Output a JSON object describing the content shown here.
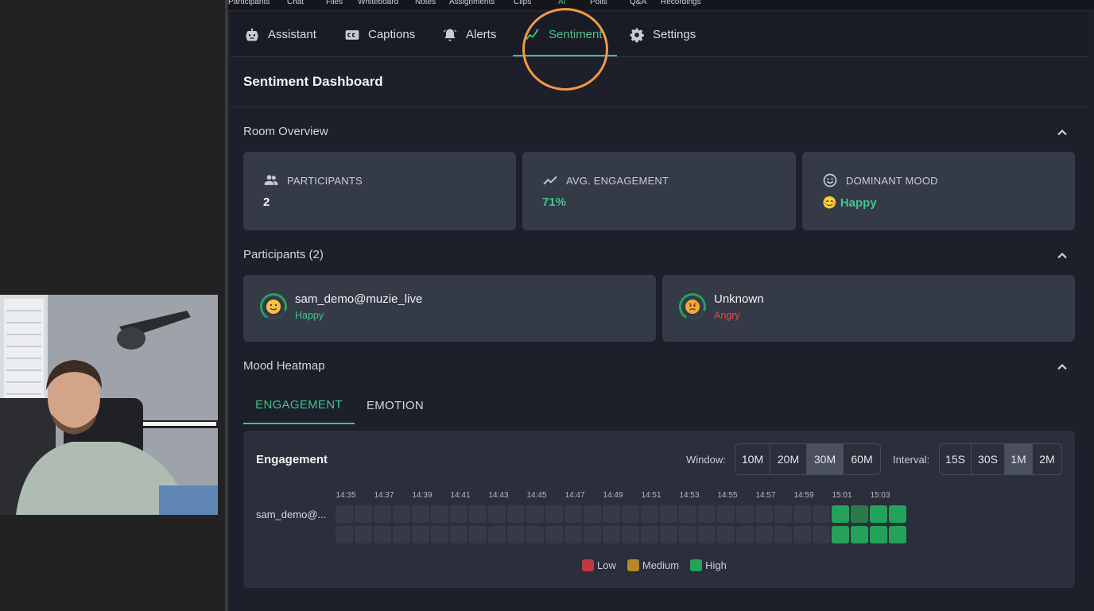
{
  "top_nav": [
    "Participants",
    "Chat",
    "Files",
    "Whiteboard",
    "Notes",
    "Assignments",
    "Clips",
    "AI",
    "Polls",
    "Q&A",
    "Recordings"
  ],
  "tabs": [
    {
      "label": "Assistant",
      "icon": "robot-icon"
    },
    {
      "label": "Captions",
      "icon": "closed-captions-icon"
    },
    {
      "label": "Alerts",
      "icon": "alarm-bell-icon"
    },
    {
      "label": "Sentiment",
      "icon": "sparkle-trend-icon",
      "active": true
    },
    {
      "label": "Settings",
      "icon": "gear-icon"
    }
  ],
  "dashboard_title": "Sentiment Dashboard",
  "room_overview": {
    "title": "Room Overview",
    "stats": [
      {
        "label": "PARTICIPANTS",
        "value": "2",
        "icon": "people-icon"
      },
      {
        "label": "AVG. ENGAGEMENT",
        "value": "71%",
        "icon": "trend-line-icon"
      },
      {
        "label": "DOMINANT MOOD",
        "value": "😊 Happy",
        "icon": "smiley-icon"
      }
    ]
  },
  "participants": {
    "title": "Participants (2)",
    "list": [
      {
        "name": "sam_demo@muzie_live",
        "mood": "Happy",
        "emoji": "😊",
        "mood_color": "#3fc48b"
      },
      {
        "name": "Unknown",
        "mood": "Angry",
        "emoji": "😠",
        "mood_color": "#e5484d"
      }
    ]
  },
  "mood_heatmap": {
    "title": "Mood Heatmap",
    "tabs": [
      "ENGAGEMENT",
      "EMOTION"
    ],
    "active_tab": "ENGAGEMENT",
    "card_title": "Engagement",
    "window_label": "Window:",
    "window_options": [
      "10M",
      "20M",
      "30M",
      "60M"
    ],
    "window_selected": "30M",
    "interval_label": "Interval:",
    "interval_options": [
      "15S",
      "30S",
      "1M",
      "2M"
    ],
    "interval_selected": "1M",
    "time_ticks": [
      "14:35",
      "14:37",
      "14:39",
      "14:41",
      "14:43",
      "14:45",
      "14:47",
      "14:49",
      "14:51",
      "14:53",
      "14:55",
      "14:57",
      "14:59",
      "15:01",
      "15:03"
    ],
    "row_label": "sam_demo@...",
    "total_columns": 30,
    "legend": [
      {
        "label": "Low",
        "color": "#c0393f"
      },
      {
        "label": "Medium",
        "color": "#b58a1f"
      },
      {
        "label": "High",
        "color": "#23a35a"
      }
    ]
  },
  "colors": {
    "accent": "#3fc48b",
    "click_ring": "#f39a42",
    "panel_bg": "#1d1f2b",
    "card_bg": "#353a47"
  }
}
